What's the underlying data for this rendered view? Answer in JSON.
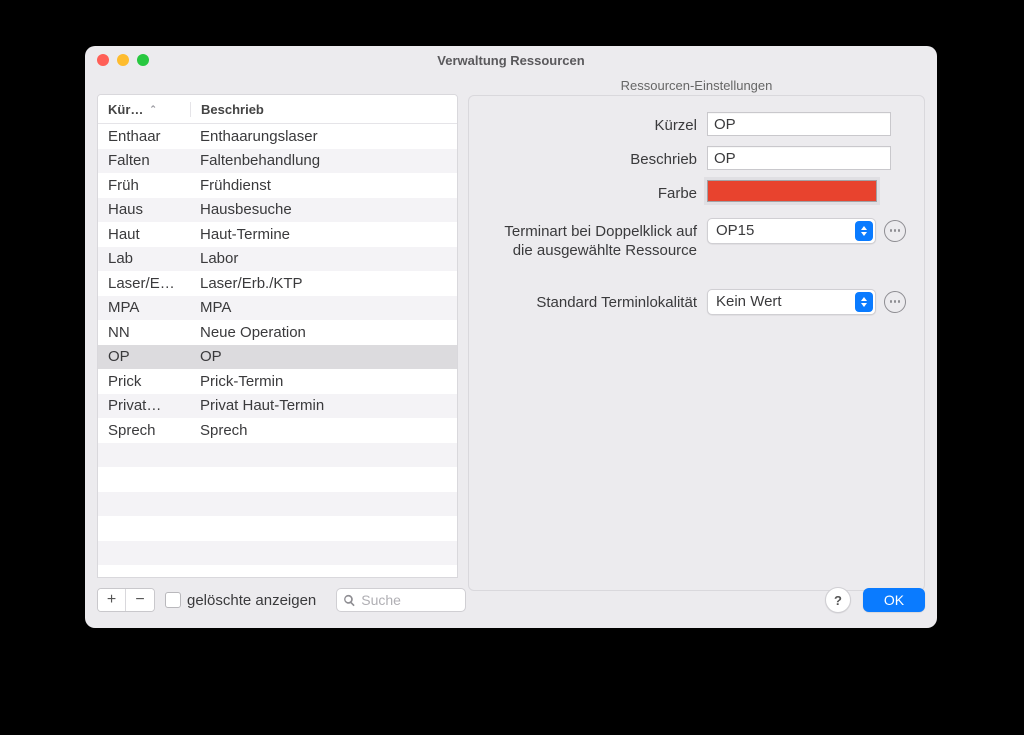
{
  "window": {
    "title": "Verwaltung Ressourcen"
  },
  "table": {
    "columns": {
      "code": "Kür…",
      "description": "Beschrieb"
    },
    "sort": {
      "column": "code",
      "ascending": true
    },
    "rows": [
      {
        "code": "Enthaar",
        "description": "Enthaarungslaser"
      },
      {
        "code": "Falten",
        "description": "Faltenbehandlung"
      },
      {
        "code": "Früh",
        "description": "Frühdienst"
      },
      {
        "code": "Haus",
        "description": "Hausbesuche"
      },
      {
        "code": "Haut",
        "description": "Haut-Termine"
      },
      {
        "code": "Lab",
        "description": "Labor"
      },
      {
        "code": "Laser/E…",
        "description": "Laser/Erb./KTP"
      },
      {
        "code": "MPA",
        "description": "MPA"
      },
      {
        "code": "NN",
        "description": "Neue Operation"
      },
      {
        "code": "OP",
        "description": "OP"
      },
      {
        "code": "Prick",
        "description": "Prick-Termin"
      },
      {
        "code": "Privat…",
        "description": "Privat Haut-Termin"
      },
      {
        "code": "Sprech",
        "description": "Sprech"
      }
    ],
    "selectedIndex": 9,
    "emptyRowsPadding": 5
  },
  "settings": {
    "sectionTitle": "Ressourcen-Einstellungen",
    "labels": {
      "code": "Kürzel",
      "description": "Beschrieb",
      "color": "Farbe",
      "appointmentType": "Terminart bei Doppelklick auf die ausgewählte Ressource",
      "defaultLocality": "Standard Terminlokalität"
    },
    "values": {
      "code": "OP",
      "description": "OP",
      "color": "#e8432e",
      "appointmentType": "OP15",
      "defaultLocality": "Kein Wert"
    }
  },
  "toolbar": {
    "showDeleted_label": "gelöschte anzeigen",
    "search_placeholder": "Suche",
    "help_label": "?",
    "ok_label": "OK"
  },
  "icons": {
    "plus": "+",
    "minus": "−",
    "sortAsc": "⌃"
  }
}
